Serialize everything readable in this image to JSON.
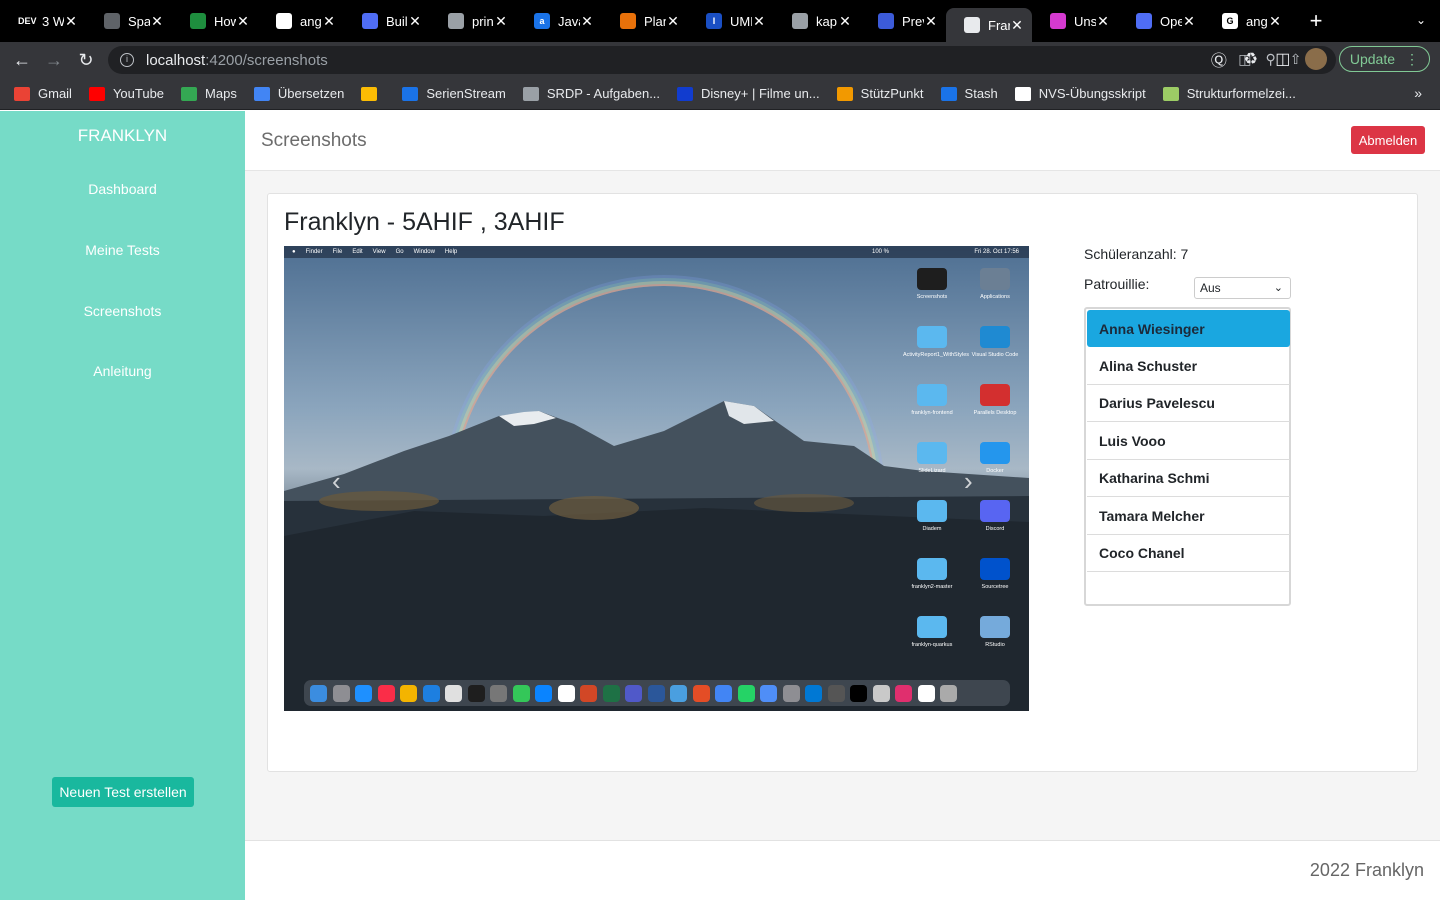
{
  "browser": {
    "tabs": [
      {
        "label": "3 W",
        "icon": "dev-icon",
        "fav_text": "DEV",
        "color": "#000000"
      },
      {
        "label": "Spa",
        "icon": "spa-icon",
        "fav_text": "",
        "color": "#5f6368"
      },
      {
        "label": "How",
        "icon": "infinity-icon",
        "fav_text": "",
        "color": "#1e8e3e"
      },
      {
        "label": "ang",
        "icon": "github-icon",
        "fav_text": "",
        "color": "#ffffff"
      },
      {
        "label": "Buil",
        "icon": "app-icon",
        "fav_text": "",
        "color": "#4f6df5"
      },
      {
        "label": "prin",
        "icon": "globe-icon",
        "fav_text": "",
        "color": "#9aa0a6"
      },
      {
        "label": "Java",
        "icon": "amazon-icon",
        "fav_text": "a",
        "color": "#1a73e8"
      },
      {
        "label": "Plan",
        "icon": "plan-icon",
        "fav_text": "",
        "color": "#e8710a"
      },
      {
        "label": "UML",
        "icon": "uml-icon",
        "fav_text": "I",
        "color": "#1a4fc4"
      },
      {
        "label": "kap",
        "icon": "globe-icon",
        "fav_text": "",
        "color": "#9aa0a6"
      },
      {
        "label": "Prev",
        "icon": "preview-icon",
        "fav_text": "",
        "color": "#3c5bd9"
      },
      {
        "label": "Frar",
        "icon": "franklyn-icon",
        "fav_text": "",
        "color": "#e8eaed"
      },
      {
        "label": "Uns",
        "icon": "unsplash-icon",
        "fav_text": "",
        "color": "#d53ad0"
      },
      {
        "label": "Ope",
        "icon": "app-icon",
        "fav_text": "",
        "color": "#4f6df5"
      },
      {
        "label": "ang",
        "icon": "google-icon",
        "fav_text": "G",
        "color": "#ffffff"
      }
    ],
    "active_tab_index": 11,
    "url_host": "localhost",
    "url_path": ":4200/screenshots",
    "update_label": "Update",
    "bookmarks": [
      {
        "label": "Gmail",
        "color": "#ea4335"
      },
      {
        "label": "YouTube",
        "color": "#ff0000"
      },
      {
        "label": "Maps",
        "color": "#34a853"
      },
      {
        "label": "Übersetzen",
        "color": "#4285f4"
      },
      {
        "label": "",
        "color": "#fbbc04"
      },
      {
        "label": "SerienStream",
        "color": "#1a73e8"
      },
      {
        "label": "SRDP - Aufgaben...",
        "color": "#9aa0a6"
      },
      {
        "label": "Disney+ | Filme un...",
        "color": "#113ccf"
      },
      {
        "label": "StützPunkt",
        "color": "#f29900"
      },
      {
        "label": "Stash",
        "color": "#1a73e8"
      },
      {
        "label": "NVS-Übungsskript",
        "color": "#ffffff"
      },
      {
        "label": "Strukturformelzei...",
        "color": "#9ccc65"
      }
    ]
  },
  "app": {
    "brand": "FRANKLYN",
    "nav": [
      "Dashboard",
      "Meine Tests",
      "Screenshots",
      "Anleitung"
    ],
    "new_test_label": "Neuen Test erstellen",
    "page_title": "Screenshots",
    "logout_label": "Abmelden",
    "card_title": "Franklyn - 5AHIF , 3AHIF",
    "student_count_label": "Schüleranzahl: 7",
    "patrol_label": "Patrouillie:",
    "patrol_value": "Aus",
    "students": [
      "Anna Wiesinger",
      "Alina Schuster",
      "Darius Pavelescu",
      "Luis Vooo",
      "Katharina Schmi",
      "Tamara Melcher",
      "Coco Chanel"
    ],
    "selected_student_index": 0,
    "footer": "2022 Franklyn",
    "accent_color": "#76dbc7",
    "danger_color": "#dc3545",
    "selection_color": "#1aa7e0"
  },
  "screenshot": {
    "menubar_left": [
      "Finder",
      "File",
      "Edit",
      "View",
      "Go",
      "Window",
      "Help"
    ],
    "menubar_right": "Fri 28. Oct  17:56",
    "battery": "100 %",
    "desktop_icons": [
      {
        "label": "Screenshots",
        "color": "#1e1e1e"
      },
      {
        "label": "Applications",
        "color": "#6b7f94"
      },
      {
        "label": "ActivityReport1_WithStyles",
        "color": "#5bb8ef"
      },
      {
        "label": "Visual Studio Code",
        "color": "#1f8ad2"
      },
      {
        "label": "franklyn-frontend",
        "color": "#5bb8ef"
      },
      {
        "label": "Parallels Desktop",
        "color": "#d32f2f"
      },
      {
        "label": "SlideLizard",
        "color": "#5bb8ef"
      },
      {
        "label": "Docker",
        "color": "#2496ed"
      },
      {
        "label": "Diadem",
        "color": "#5bb8ef"
      },
      {
        "label": "Discord",
        "color": "#5865f2"
      },
      {
        "label": "franklyn2-master",
        "color": "#5bb8ef"
      },
      {
        "label": "Sourcetree",
        "color": "#0052cc"
      },
      {
        "label": "franklyn-quarkus",
        "color": "#5bb8ef"
      },
      {
        "label": "RStudio",
        "color": "#75aadb"
      }
    ],
    "dock_colors": [
      "#3b8de0",
      "#8e8e93",
      "#1e90ff",
      "#fa2d48",
      "#f4b400",
      "#1d7fe0",
      "#e0e0e0",
      "#1e1e1e",
      "#777777",
      "#34c759",
      "#0a84ff",
      "#ffffff",
      "#d24726",
      "#1e7145",
      "#5059c9",
      "#2b579a",
      "#4a9fe0",
      "#e44d26",
      "#4285f4",
      "#25d366",
      "#4f8ef7",
      "#8e8e93",
      "#0078d4",
      "#555555",
      "#000000",
      "#c9c9c9",
      "#e02f6e",
      "#ffffff",
      "#aaaaaa"
    ]
  }
}
